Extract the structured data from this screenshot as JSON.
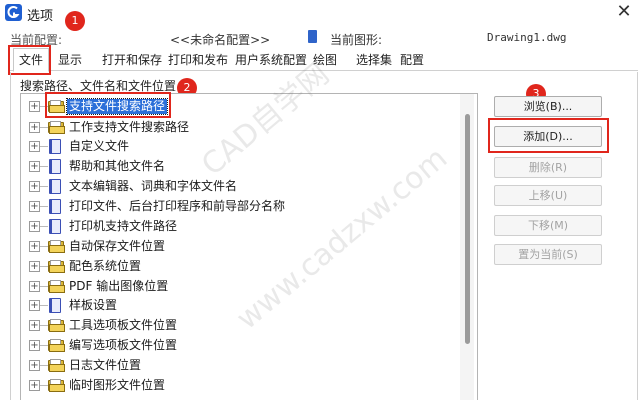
{
  "window": {
    "title": "选项",
    "app_icon": "cad-app-icon",
    "close_icon": "close-icon"
  },
  "profile": {
    "current_profile_label": "当前配置:",
    "current_profile_value": "<<未命名配置>>",
    "current_drawing_label": "当前图形:",
    "current_drawing_value": "Drawing1.dwg"
  },
  "tabs": [
    {
      "label": "文件",
      "active": true
    },
    {
      "label": "显示"
    },
    {
      "label": "打开和保存"
    },
    {
      "label": "打印和发布"
    },
    {
      "label": "用户系统配置"
    },
    {
      "label": "绘图"
    },
    {
      "label": "选择集"
    },
    {
      "label": "配置"
    }
  ],
  "list": {
    "header": "搜索路径、文件名和文件位置",
    "items": [
      {
        "label": "支持文件搜索路径",
        "icon": "folder-icon",
        "selected": true
      },
      {
        "label": "工作支持文件搜索路径",
        "icon": "folder-icon"
      },
      {
        "label": "自定义文件",
        "icon": "book-icon"
      },
      {
        "label": "帮助和其他文件名",
        "icon": "book-icon"
      },
      {
        "label": "文本编辑器、词典和字体文件名",
        "icon": "book-icon"
      },
      {
        "label": "打印文件、后台打印程序和前导部分名称",
        "icon": "book-icon"
      },
      {
        "label": "打印机支持文件路径",
        "icon": "book-icon"
      },
      {
        "label": "自动保存文件位置",
        "icon": "folder-icon"
      },
      {
        "label": "配色系统位置",
        "icon": "folder-icon"
      },
      {
        "label": "PDF 输出图像位置",
        "icon": "folder-icon"
      },
      {
        "label": "样板设置",
        "icon": "book-icon"
      },
      {
        "label": "工具选项板文件位置",
        "icon": "folder-icon"
      },
      {
        "label": "编写选项板文件位置",
        "icon": "folder-icon"
      },
      {
        "label": "日志文件位置",
        "icon": "folder-icon"
      },
      {
        "label": "临时图形文件位置",
        "icon": "folder-icon"
      }
    ]
  },
  "buttons": {
    "browse": "浏览(B)...",
    "add": "添加(D)...",
    "remove": "删除(R)",
    "move_up": "上移(U)",
    "move_down": "下移(M)",
    "set_current": "置为当前(S)"
  },
  "markers": {
    "one": "1",
    "two": "2",
    "three": "3"
  },
  "watermark": {
    "text1": "CAD自学网",
    "text2": "www.cadzxw.com"
  },
  "colors": {
    "accent": "#2b6fd9",
    "highlight": "#e0261c"
  }
}
